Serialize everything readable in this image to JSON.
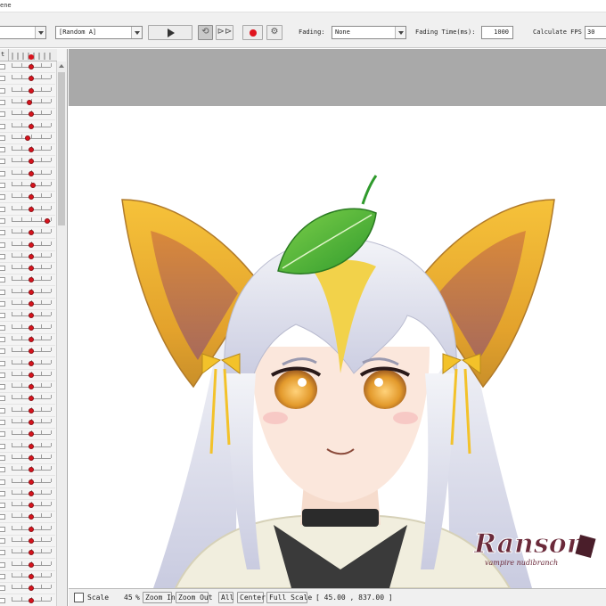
{
  "window": {
    "title_fragment": "ene"
  },
  "toolbar": {
    "motion_select": "[Random A]",
    "fading_label": "Fading:",
    "fading_value": "None",
    "fading_time_label": "Fading Time(ms):",
    "fading_time_value": "1000",
    "fps_label": "Calculate FPS",
    "fps_value": "30",
    "record_color": "#e0141e"
  },
  "panel": {
    "header_tab": "t",
    "knob_color": "#d8131d",
    "param_positions": [
      0.5,
      0.5,
      0.5,
      0.45,
      0.5,
      0.5,
      0.4,
      0.5,
      0.5,
      0.5,
      0.55,
      0.5,
      0.5,
      0.9,
      0.5,
      0.5,
      0.5,
      0.5,
      0.5,
      0.5,
      0.5,
      0.5,
      0.5,
      0.5,
      0.5,
      0.5,
      0.5,
      0.5,
      0.5,
      0.5,
      0.5,
      0.5,
      0.5,
      0.5,
      0.5,
      0.5,
      0.5,
      0.5,
      0.5,
      0.5,
      0.5,
      0.5,
      0.5,
      0.5,
      0.5,
      0.5
    ]
  },
  "statusbar": {
    "scale_label": "Scale",
    "zoom_value": "45",
    "zoom_unit": "%",
    "zoom_in": "Zoom In",
    "zoom_out": "Zoom Out",
    "all": "All",
    "center": "Center",
    "full_scale": "Full Scale",
    "coords": "[   45.00 ,  837.00 ]"
  },
  "watermark": {
    "line1": "Ransom",
    "line2": "vampire nudibranch"
  }
}
